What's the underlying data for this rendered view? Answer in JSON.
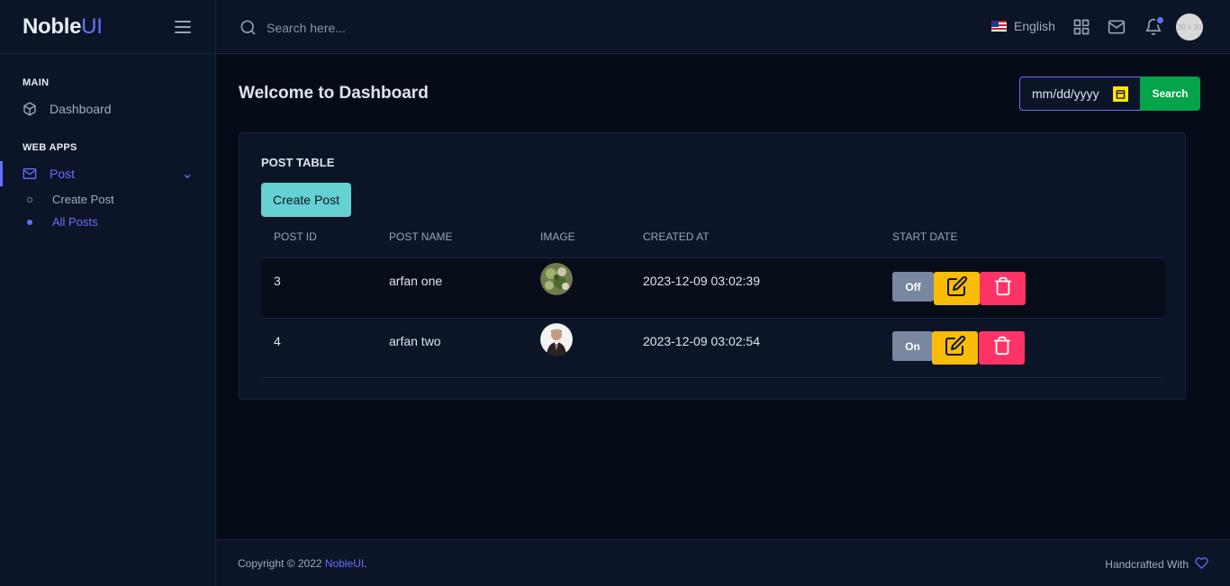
{
  "brand": {
    "main": "Noble",
    "accent": "UI"
  },
  "sidebar": {
    "categories": [
      "MAIN",
      "WEB APPS"
    ],
    "items": [
      {
        "label": "Dashboard",
        "icon": "box-icon"
      },
      {
        "label": "Post",
        "icon": "mail-icon",
        "active": true
      }
    ],
    "sub_items": [
      {
        "label": "Create Post"
      },
      {
        "label": "All Posts",
        "active": true
      }
    ]
  },
  "topbar": {
    "search_placeholder": "Search here...",
    "language": "English",
    "avatar_text": "30 x 30"
  },
  "main": {
    "title": "Welcome to Dashboard",
    "date_placeholder": "mm/dd/yyyy",
    "search_button": "Search"
  },
  "table": {
    "title": "POST TABLE",
    "create_button": "Create Post",
    "headers": [
      "POST ID",
      "POST NAME",
      "IMAGE",
      "CREATED AT",
      "START DATE"
    ],
    "rows": [
      {
        "id": "3",
        "name": "arfan one",
        "created_at": "2023-12-09 03:02:39",
        "toggle": "Off"
      },
      {
        "id": "4",
        "name": "arfan two",
        "created_at": "2023-12-09 03:02:54",
        "toggle": "On"
      }
    ]
  },
  "footer": {
    "copyright_prefix": "Copyright © 2022 ",
    "copyright_link": "NobleUI",
    "copyright_suffix": ".",
    "handcrafted": "Handcrafted With"
  },
  "colors": {
    "accent": "#6571ff",
    "success": "#05a34a",
    "info": "#66d1d1",
    "warning": "#fbbc06",
    "danger": "#ff3366",
    "secondary": "#7987a1"
  }
}
